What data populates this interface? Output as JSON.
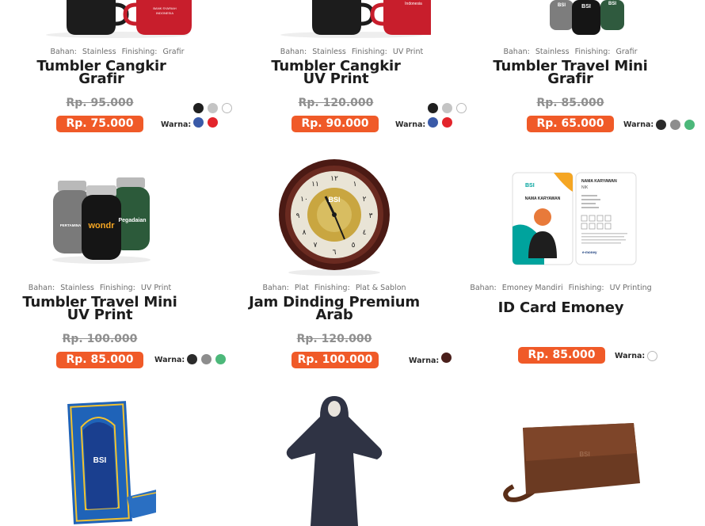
{
  "colors": {
    "accent": "#f05a28",
    "swatch_black": "#1f1f1f",
    "swatch_silver": "#c4c4c4",
    "swatch_white": "#ffffff",
    "swatch_blue": "#3a5aa8",
    "swatch_red": "#e3242b",
    "swatch_gray": "#8d8d8d",
    "swatch_green": "#4cb87a",
    "swatch_brown": "#4a1f1b"
  },
  "labels": {
    "bahan": "Bahan:",
    "finishing": "Finishing:",
    "warna": "Warna:"
  },
  "products": [
    {
      "bahan": "Stainless",
      "finishing": "Grafir",
      "title_1": "Tumbler Cangkir",
      "title_2": "Grafir",
      "old_price": "Rp. 95.000",
      "price": "Rp. 75.000",
      "swatches": [
        "black",
        "silver",
        "white",
        "blue",
        "red"
      ]
    },
    {
      "bahan": "Stainless",
      "finishing": "UV Print",
      "title_1": "Tumbler Cangkir",
      "title_2": "UV Print",
      "old_price": "Rp. 120.000",
      "price": "Rp. 90.000",
      "swatches": [
        "black",
        "silver",
        "white",
        "blue",
        "red"
      ]
    },
    {
      "bahan": "Stainless",
      "finishing": "Grafir",
      "title_1": "Tumbler Travel Mini",
      "title_2": "Grafir",
      "old_price": "Rp. 85.000",
      "price": "Rp. 65.000",
      "swatches": [
        "black",
        "gray",
        "green"
      ]
    },
    {
      "bahan": "Stainless",
      "finishing": "UV Print",
      "title_1": "Tumbler Travel Mini",
      "title_2": "UV Print",
      "old_price": "Rp. 100.000",
      "price": "Rp. 85.000",
      "swatches": [
        "black",
        "gray",
        "green"
      ]
    },
    {
      "bahan": "Plat",
      "finishing": "Plat & Sablon",
      "title_1": "Jam Dinding Premium",
      "title_2": "Arab",
      "old_price": "Rp. 120.000",
      "price": "Rp. 100.000",
      "swatches": [
        "brown"
      ]
    },
    {
      "bahan": "Emoney Mandiri",
      "finishing": "UV Printing",
      "title_1": "ID Card Emoney",
      "title_2": "",
      "old_price": "",
      "price": "Rp. 85.000",
      "swatches": [
        "white"
      ]
    }
  ],
  "image_text": {
    "bank": "BSI",
    "mug_brand": "Indonesia",
    "bottle_logo_1": "wondr",
    "bottle_logo_2": "Pegadaian",
    "bottle_logo_3": "PERTAMINA",
    "card_name": "NAMA KARYAWAN",
    "card_back_name": "NAMA KARYAWAN",
    "card_back_nik": "NIK",
    "card_emoney": "e-money"
  }
}
